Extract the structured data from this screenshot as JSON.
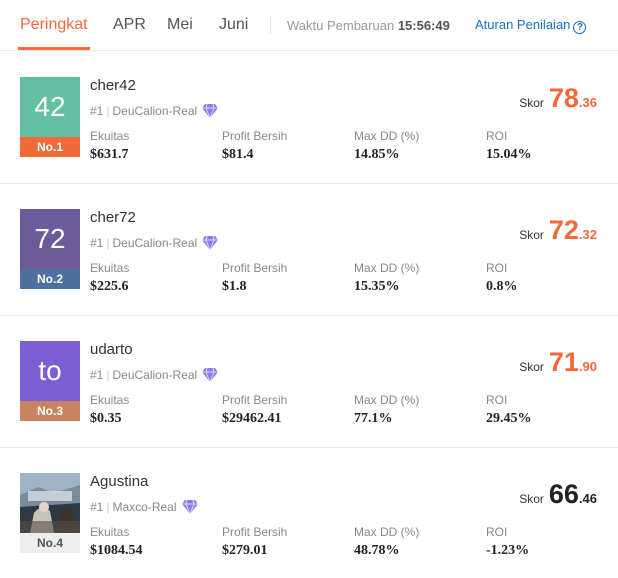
{
  "tabs": [
    {
      "label": "Peringkat",
      "active": true
    },
    {
      "label": "APR",
      "active": false
    },
    {
      "label": "Mei",
      "active": false
    },
    {
      "label": "Juni",
      "active": false
    }
  ],
  "update": {
    "label": "Waktu Pembaruan",
    "time": "15:56:49"
  },
  "rules_link": {
    "label": "Aturan Penilaian",
    "icon": "question-circle-icon"
  },
  "colors": {
    "accent": "#f26a3a",
    "link": "#1a6fc4",
    "gem": "#8e7be8"
  },
  "stat_labels": {
    "equity": "Ekuitas",
    "profit": "Profit Bersih",
    "maxdd": "Max DD (%)",
    "roi": "ROI"
  },
  "score_label": "Skor",
  "traders": [
    {
      "avatar_text": "42",
      "avatar_color": "#62bfa2",
      "rank_label": "No.1",
      "rank_color": "#f26a3a",
      "name": "cher42",
      "position": "#1",
      "account": "DeuCalion-Real",
      "equity": "$631.7",
      "profit": "$81.4",
      "maxdd": "14.85%",
      "roi": "15.04%",
      "score_int": "78",
      "score_dec": ".36",
      "score_color": "#f26a3a"
    },
    {
      "avatar_text": "72",
      "avatar_color": "#6b5b9a",
      "rank_label": "No.2",
      "rank_color": "#4f6f9e",
      "name": "cher72",
      "position": "#1",
      "account": "DeuCalion-Real",
      "equity": "$225.6",
      "profit": "$1.8",
      "maxdd": "15.35%",
      "roi": "0.8%",
      "score_int": "72",
      "score_dec": ".32",
      "score_color": "#f26a3a"
    },
    {
      "avatar_text": "to",
      "avatar_color": "#7b5ed6",
      "rank_label": "No.3",
      "rank_color": "#c8845e",
      "name": "udarto",
      "position": "#1",
      "account": "DeuCalion-Real",
      "equity": "$0.35",
      "profit": "$29462.41",
      "maxdd": "77.1%",
      "roi": "29.45%",
      "score_int": "71",
      "score_dec": ".90",
      "score_color": "#f26a3a"
    },
    {
      "avatar_text": "",
      "avatar_color": "#4a5568",
      "rank_label": "No.4",
      "rank_color": "#eeeeee",
      "name": "Agustina",
      "position": "#1",
      "account": "Maxco-Real",
      "equity": "$1084.54",
      "profit": "$279.01",
      "maxdd": "48.78%",
      "roi": "-1.23%",
      "score_int": "66",
      "score_dec": ".46",
      "score_color": "#222222"
    }
  ]
}
